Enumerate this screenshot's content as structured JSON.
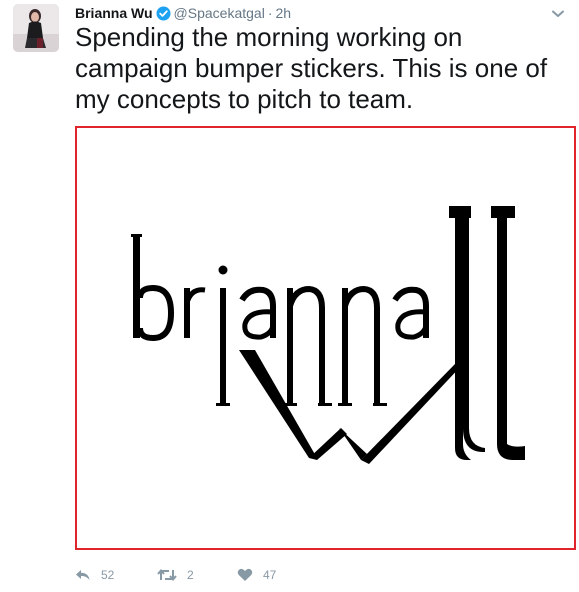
{
  "tweet": {
    "author": {
      "display_name": "Brianna Wu",
      "handle": "@Spacekatgal",
      "verified": true,
      "avatar_icon": "avatar"
    },
    "separator": "·",
    "time": "2h",
    "text": "Spending the morning working on campaign bumper stickers. This is one of my concepts to pitch to team.",
    "media": {
      "logo_text": "brianna wu",
      "border_color": "#e0242b"
    },
    "actions": {
      "reply": {
        "icon": "reply-icon",
        "count": "52"
      },
      "retweet": {
        "icon": "retweet-icon",
        "count": "2"
      },
      "like": {
        "icon": "heart-icon",
        "count": "47"
      }
    }
  },
  "colors": {
    "text": "#14171a",
    "muted": "#657786",
    "action_gray": "#8899a6",
    "verified_blue": "#1da1f2"
  }
}
